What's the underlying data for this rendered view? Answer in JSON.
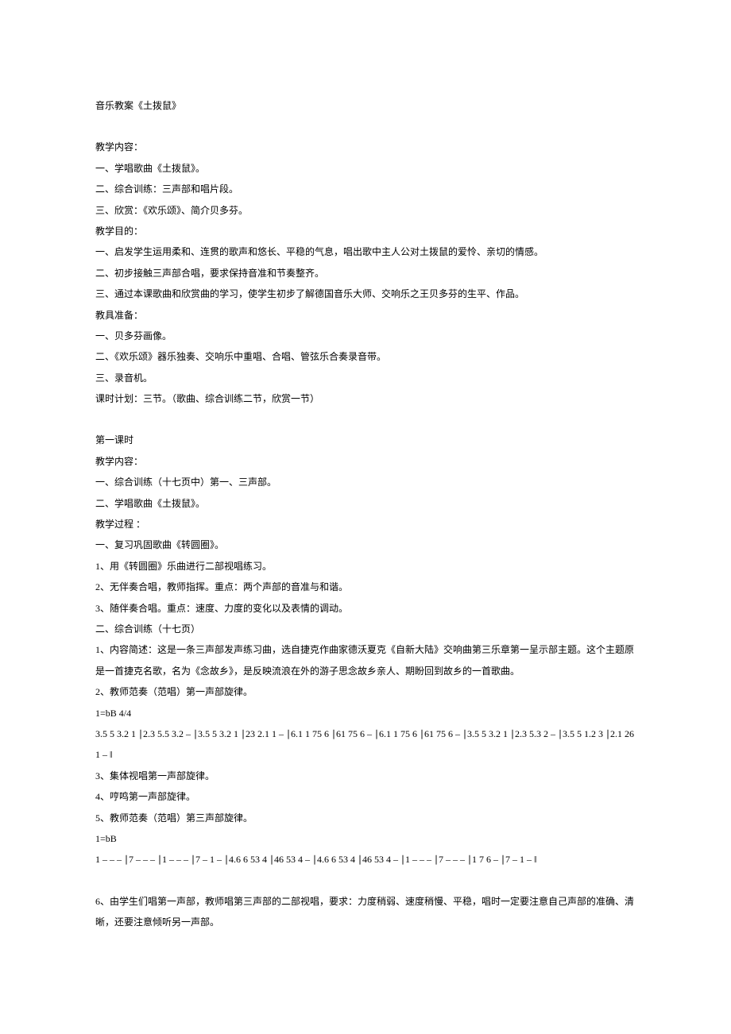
{
  "title": "音乐教案《土拨鼠》",
  "section1": {
    "heading": "教学内容：",
    "items": [
      "一、学唱歌曲《土拨鼠》。",
      "二、综合训练：三声部和唱片段。",
      "三、欣赏：《欢乐颂》、简介贝多芬。"
    ]
  },
  "section2": {
    "heading": "教学目的：",
    "items": [
      "一、启发学生运用柔和、连贯的歌声和悠长、平稳的气息，唱出歌中主人公对土拨鼠的爱怜、亲切的情感。",
      "二、初步接触三声部合唱，要求保持音准和节奏整齐。",
      "三、通过本课歌曲和欣赏曲的学习，使学生初步了解德国音乐大师、交响乐之王贝多芬的生平、作品。"
    ]
  },
  "section3": {
    "heading": "教具准备：",
    "items": [
      "一、贝多芬画像。",
      "二、《欢乐颂》器乐独奏、交响乐中重唱、合唱、管弦乐合奏录音带。",
      "三、录音机。"
    ]
  },
  "schedule": "课时计划：三节。（歌曲、综合训练二节，欣赏一节）",
  "lesson1": {
    "title": "第一课时",
    "contentHeading": "教学内容：",
    "contentItems": [
      "一、综合训练（十七页中）第一、三声部。",
      "二、学唱歌曲《土拨鼠》。"
    ],
    "processHeading": "教学过程 ：",
    "processItems": [
      "一、复习巩固歌曲《转圆圈》。",
      "1、用《转圆圈》乐曲进行二部视唱练习。",
      "2、无伴奏合唱，教师指挥。重点：两个声部的音准与和谐。",
      "3、随伴奏合唱。重点：速度、力度的变化以及表情的调动。",
      "二、综合训练（十七页）",
      "1、内容简述：这是一条三声部发声练习曲，选自捷克作曲家德沃夏克《自新大陆》交响曲第三乐章第一呈示部主题。这个主题原是一首捷克名歌，名为《念故乡》，是反映流浪在外的游子思念故乡亲人、期盼回到故乡的一首歌曲。",
      "2、教师范奏（范唱）第一声部旋律。",
      "1=bB 4/4",
      "3.5 5 3.2 1 ∣2.3 5.5 3.2 – ∣3.5 5 3.2 1 ∣23 2.1 1 – ∣6.1 1 75 6 ∣61 75 6 – ∣6.1 1 75 6 ∣61 75 6 – ∣3.5 5 3.2 1 ∣2.3 5.3 2 – ∣3.5 5 1.2 3 ∣2.1 26 1 – ‖",
      "3、集体视唱第一声部旋律。",
      "4、哼鸣第一声部旋律。",
      "5、教师范奏（范唱）第三声部旋律。",
      "1=bB",
      "1 – – – ∣7 – – – ∣1 – – – ∣7 – 1 – ∣4.6 6 53 4 ∣46 53 4 – ∣4.6 6 53 4 ∣46 53 4 – ∣1 – – – ∣7 – – – ∣1 7 6 – ∣7 – 1 – ‖"
    ],
    "item6": "6、由学生们唱第一声部，教师唱第三声部的二部视唱，要求：力度稍弱、速度稍慢、平稳，唱时一定要注意自己声部的准确、清晰，还要注意倾听另一声部。"
  }
}
